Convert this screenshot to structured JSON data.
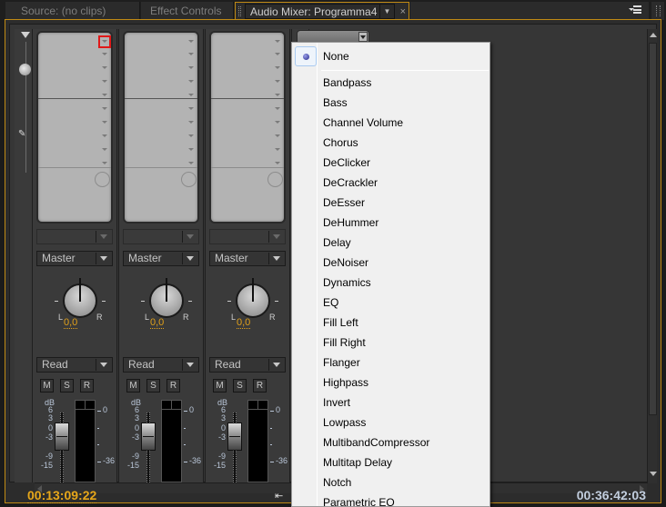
{
  "tabs": [
    {
      "label": "Source: (no clips)",
      "active": false
    },
    {
      "label": "Effect Controls",
      "active": false
    },
    {
      "label": "Audio Mixer: Programma4",
      "active": true
    }
  ],
  "channels": [
    {
      "output": "Master",
      "pan_value": "0,0",
      "automation": "Read",
      "buttons": [
        "M",
        "S",
        "R"
      ],
      "pan_labels": {
        "left": "L",
        "right": "R"
      }
    },
    {
      "output": "Master",
      "pan_value": "0,0",
      "automation": "Read",
      "buttons": [
        "M",
        "S",
        "R"
      ],
      "pan_labels": {
        "left": "L",
        "right": "R"
      }
    },
    {
      "output": "Master",
      "pan_value": "0,0",
      "automation": "Read",
      "buttons": [
        "M",
        "S",
        "R"
      ],
      "pan_labels": {
        "left": "L",
        "right": "R"
      }
    }
  ],
  "fader_scale": {
    "unit": "dB",
    "ticks": [
      "6",
      "3",
      "0",
      "-3",
      "-9",
      "-15"
    ]
  },
  "meter_scale": [
    "0",
    "-36"
  ],
  "effects_menu": {
    "selected": "None",
    "items": [
      "None",
      "Bandpass",
      "Bass",
      "Channel Volume",
      "Chorus",
      "DeClicker",
      "DeCrackler",
      "DeEsser",
      "DeHummer",
      "Delay",
      "DeNoiser",
      "Dynamics",
      "EQ",
      "Fill Left",
      "Fill Right",
      "Flanger",
      "Highpass",
      "Invert",
      "Lowpass",
      "MultibandCompressor",
      "Multitap Delay",
      "Notch",
      "Parametric EQ"
    ]
  },
  "footer": {
    "current_time": "00:13:09:22",
    "duration": "00:36:42:03"
  },
  "colors": {
    "accent": "#e7a71a",
    "highlight": "#e01818"
  }
}
